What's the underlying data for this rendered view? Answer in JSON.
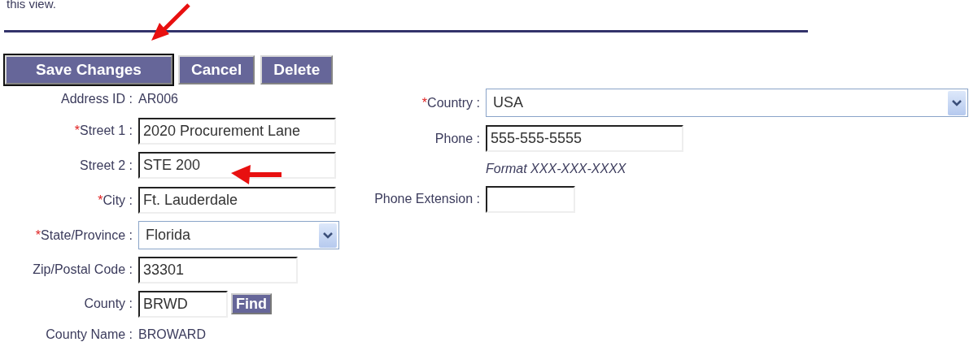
{
  "intro_text": "this view.",
  "buttons": [
    {
      "label": "Save Changes",
      "focused": true
    },
    {
      "label": "Cancel",
      "focused": false
    },
    {
      "label": "Delete",
      "focused": false
    }
  ],
  "left_fields": [
    {
      "kind": "text",
      "label": "Address ID :",
      "value": "AR006"
    },
    {
      "kind": "input",
      "marker": "*",
      "label": "Street 1 :",
      "value": "2020 Procurement Lane"
    },
    {
      "kind": "input",
      "label": "Street 2 :",
      "value": "STE 200"
    },
    {
      "kind": "input",
      "marker": "*",
      "label": "City :",
      "value": "Ft. Lauderdale"
    },
    {
      "kind": "select",
      "marker": "*",
      "label": "State/Province :",
      "value": "Florida"
    },
    {
      "kind": "input",
      "label": "Zip/Postal Code :",
      "value": "33301"
    },
    {
      "kind": "lookup",
      "label": "County :",
      "value": "BRWD",
      "button": "Find"
    },
    {
      "kind": "text",
      "label": "County Name :",
      "value": "BROWARD"
    }
  ],
  "right_fields": [
    {
      "kind": "select",
      "marker": "*",
      "label": "Country :",
      "value": "USA"
    },
    {
      "kind": "input",
      "label": "Phone :",
      "value": "555-555-5555"
    },
    {
      "kind": "hint",
      "value": "Format XXX-XXX-XXXX"
    },
    {
      "kind": "input",
      "label": "Phone Extension :"
    }
  ]
}
